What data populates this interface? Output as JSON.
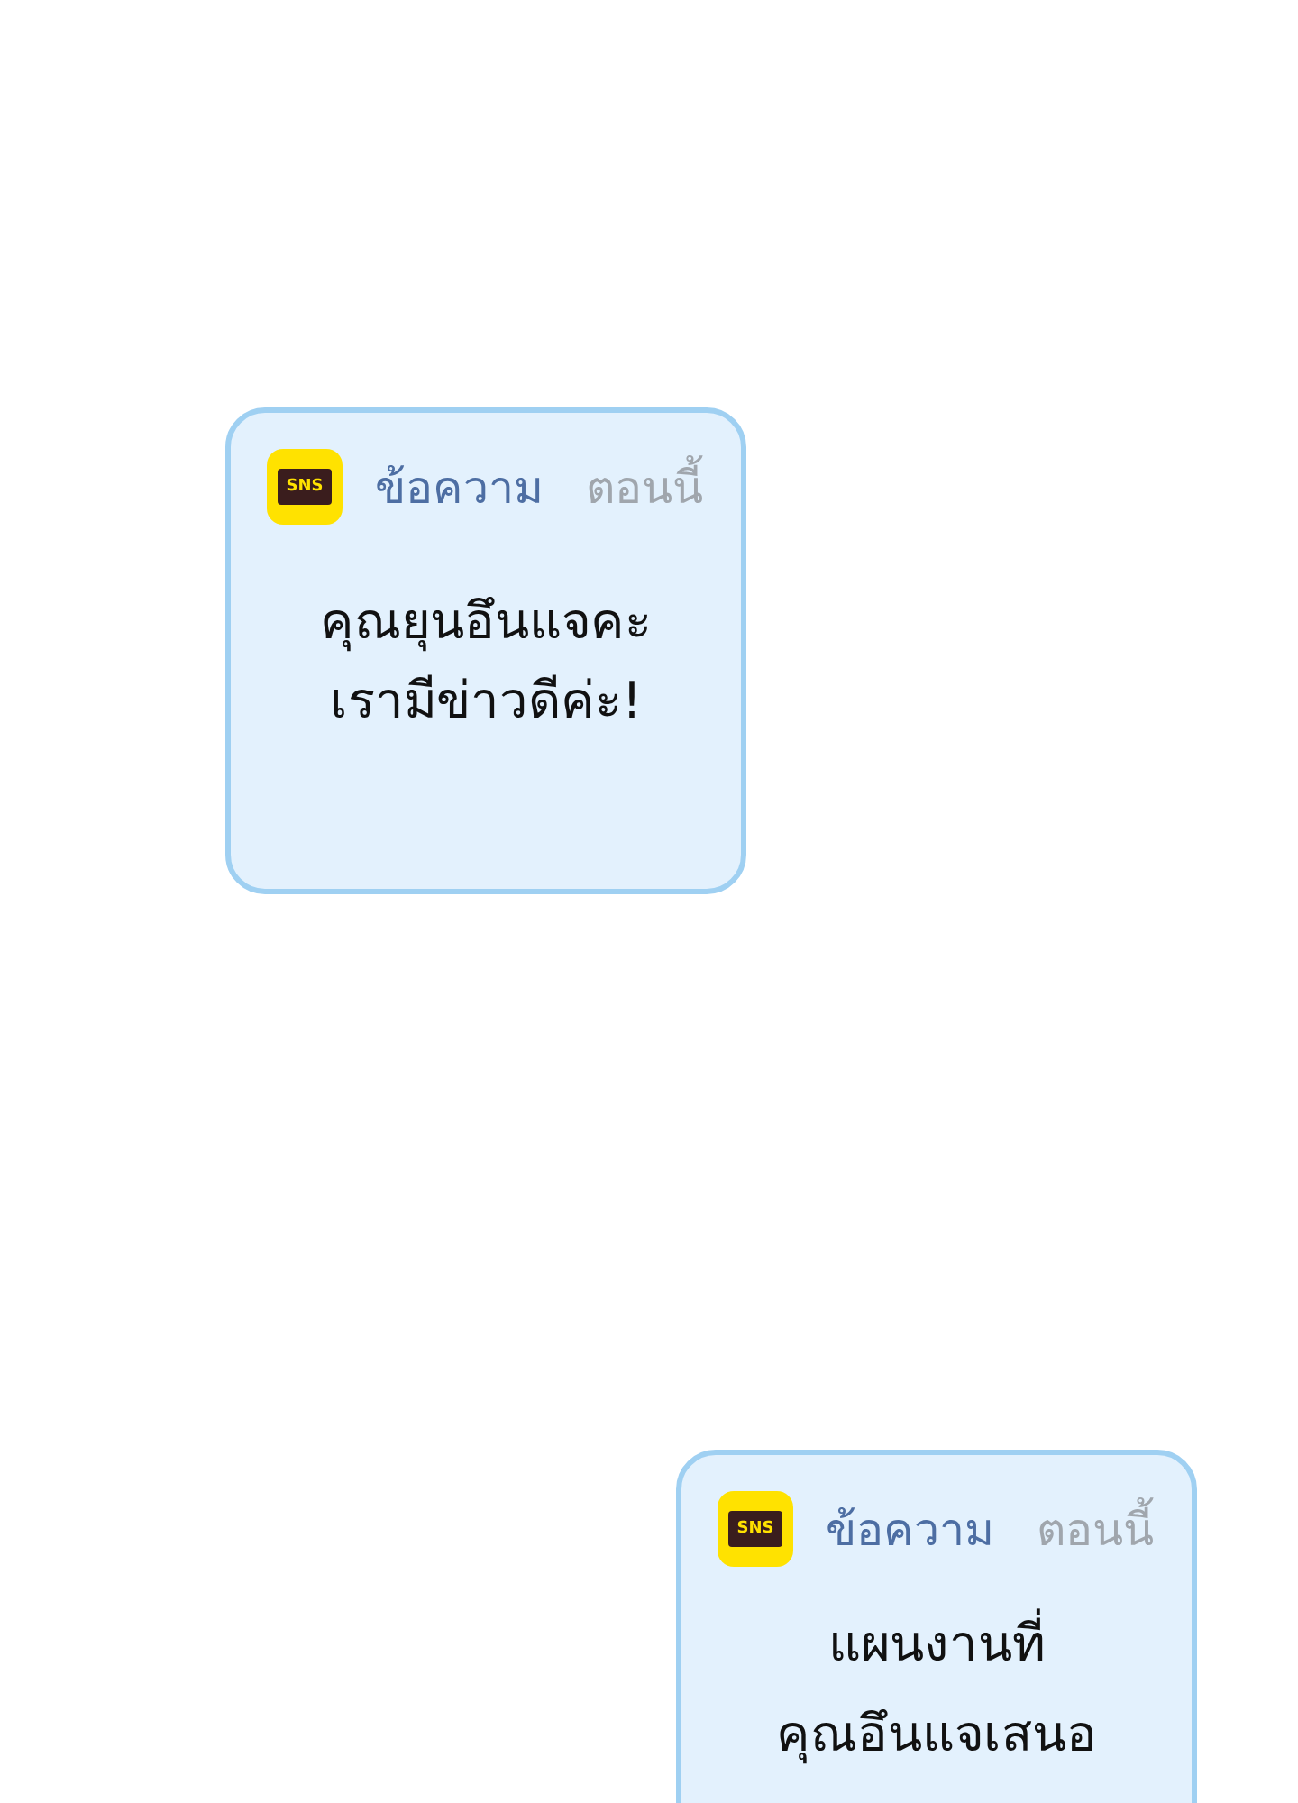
{
  "notifications": [
    {
      "app_icon": "SNS",
      "title": "ข้อความ",
      "time": "ตอนนี้",
      "lines": [
        "คุณยุนอึนแจคะ",
        "เรามีข่าวดีค่ะ!"
      ]
    },
    {
      "app_icon": "SNS",
      "title": "ข้อความ",
      "time": "ตอนนี้",
      "lines": [
        "แผนงานที่",
        "คุณอึนแจเสนอ"
      ]
    }
  ]
}
